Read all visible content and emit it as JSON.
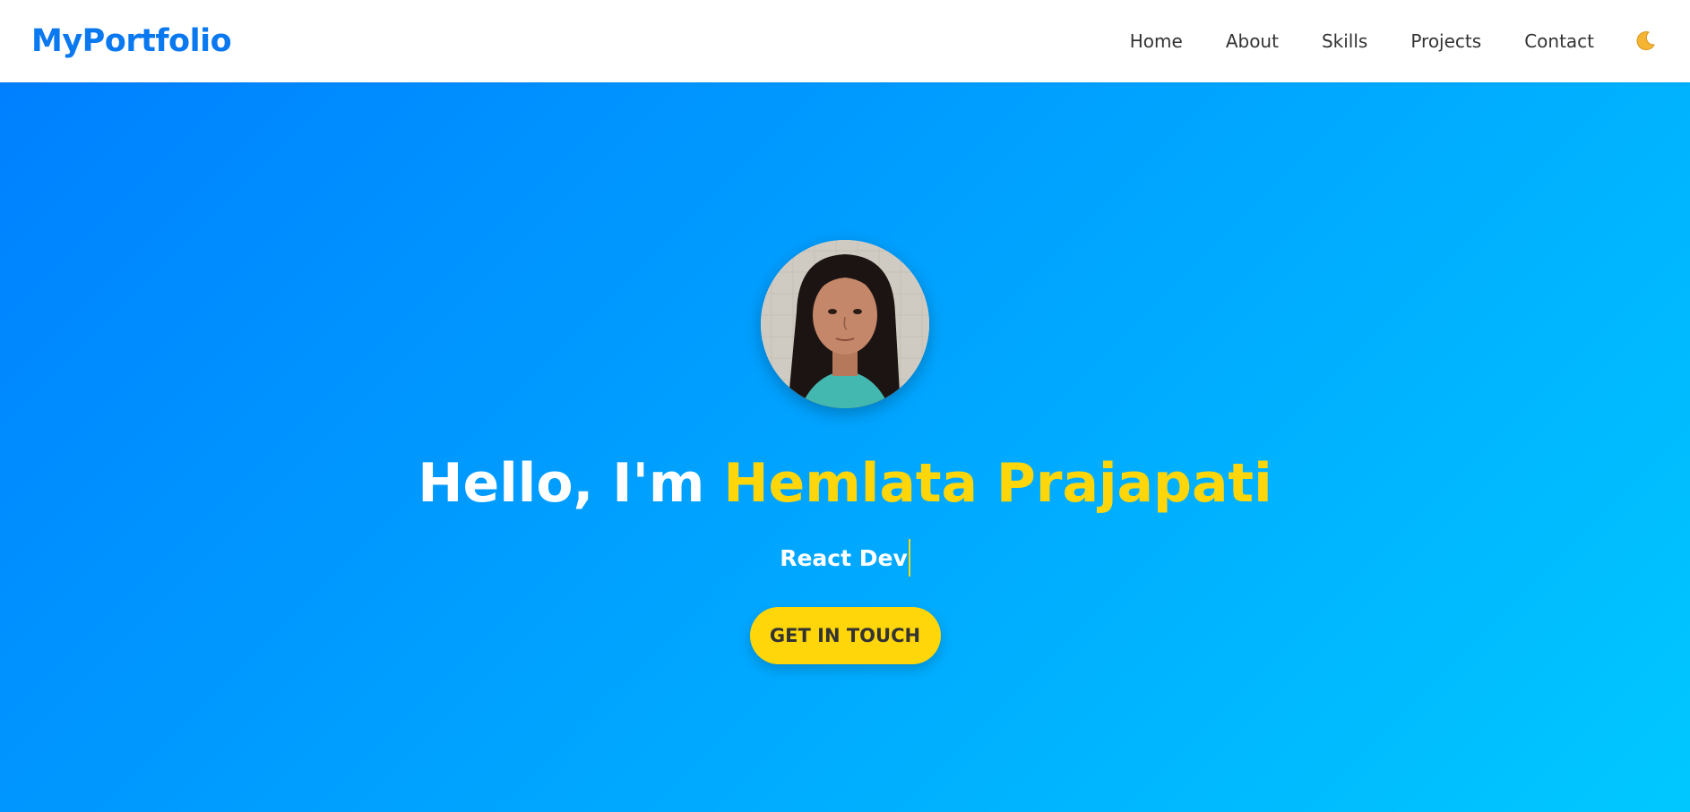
{
  "brand": {
    "name": "MyPortfolio"
  },
  "nav": {
    "items": [
      {
        "label": "Home"
      },
      {
        "label": "About"
      },
      {
        "label": "Skills"
      },
      {
        "label": "Projects"
      },
      {
        "label": "Contact"
      }
    ],
    "theme_toggle_icon": "moon-icon"
  },
  "hero": {
    "greeting": "Hello, I'm ",
    "name": "Hemlata Prajapati",
    "typed_text": "React Dev",
    "cta_label": "GET IN TOUCH"
  },
  "colors": {
    "brand": "#0a79f0",
    "gradient_start": "#0080ff",
    "gradient_end": "#00c8ff",
    "accent_yellow": "#ffd60a",
    "nav_text": "#333333"
  }
}
